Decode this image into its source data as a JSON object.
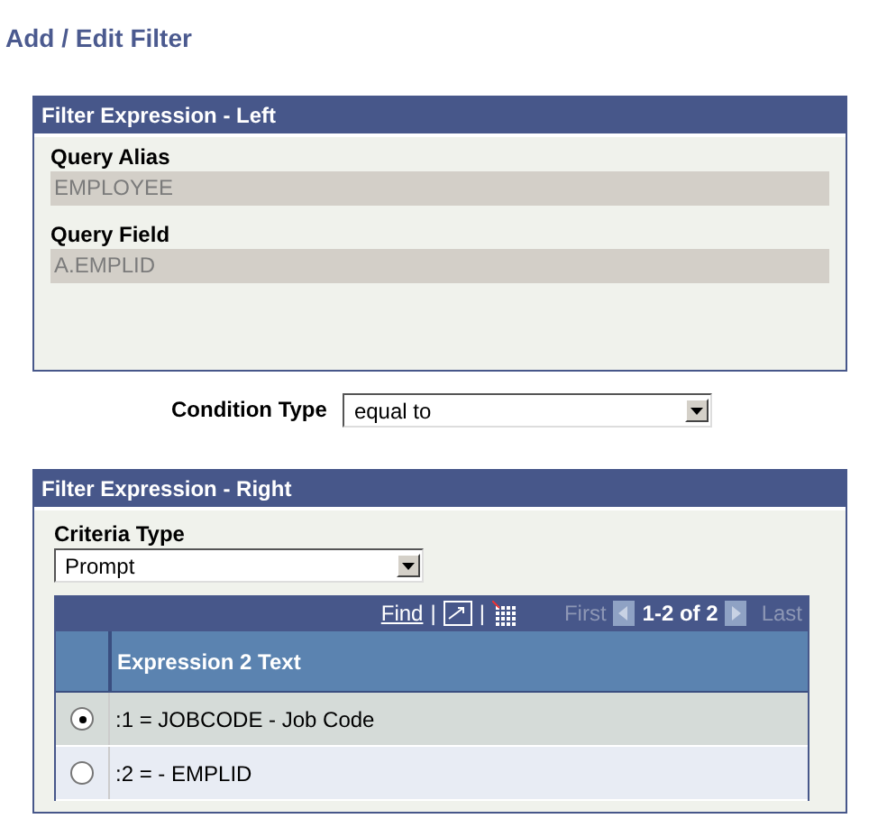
{
  "page_title": "Add / Edit Filter",
  "left_panel": {
    "title": "Filter Expression - Left",
    "fields": [
      {
        "label": "Query Alias",
        "value": "EMPLOYEE"
      },
      {
        "label": "Query Field",
        "value": "A.EMPLID"
      }
    ]
  },
  "condition_type": {
    "label": "Condition Type",
    "value": "equal to"
  },
  "right_panel": {
    "title": "Filter Expression - Right",
    "criteria_type": {
      "label": "Criteria Type",
      "value": "Prompt"
    },
    "grid": {
      "find": "Find",
      "separator_1": "|",
      "separator_2": "|",
      "first": "First",
      "range": "1-2 of 2",
      "last": "Last",
      "column": "Expression 2 Text",
      "rows": [
        {
          "text": ":1 = JOBCODE - Job Code",
          "selected": true
        },
        {
          "text": ":2 =  - EMPLID",
          "selected": false
        }
      ]
    }
  }
}
